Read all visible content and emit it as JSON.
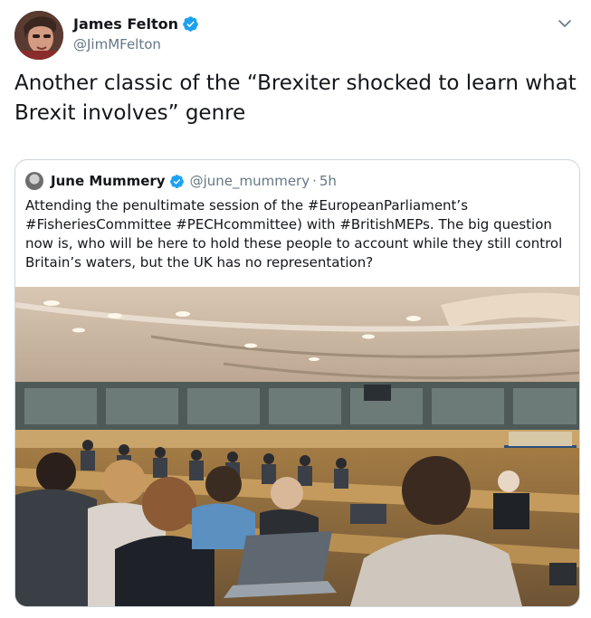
{
  "tweet": {
    "author": {
      "display_name": "James Felton",
      "handle": "@JimMFelton",
      "verified": true
    },
    "text": "Another classic of the “Brexiter shocked to learn what Brexit involves” genre",
    "menu_icon": "chevron-down-icon"
  },
  "quoted_tweet": {
    "author": {
      "display_name": "June Mummery",
      "handle": "@june_mummery",
      "verified": true
    },
    "separator": "·",
    "time": "5h",
    "text": "Attending the penultimate session of the #EuropeanParliament’s #FisheriesCommittee #PECHcommittee) with #BritishMEPs. The big question now is, who will be here to hold these people to account while they still control Britain’s waters, but the UK has no representation?",
    "media": "photo of a committee room with delegates at desks"
  },
  "colors": {
    "text_primary": "#14171a",
    "text_secondary": "#657786",
    "verified_blue": "#1da1f2",
    "border": "#ccd6dd"
  }
}
